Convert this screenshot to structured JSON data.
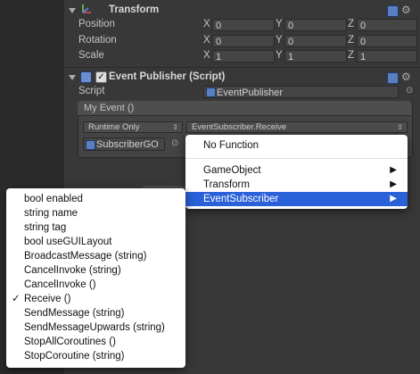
{
  "transform": {
    "title": "Transform",
    "rows": [
      {
        "label": "Position",
        "x": "0",
        "y": "0",
        "z": "0"
      },
      {
        "label": "Rotation",
        "x": "0",
        "y": "0",
        "z": "0"
      },
      {
        "label": "Scale",
        "x": "1",
        "y": "1",
        "z": "1"
      }
    ],
    "axes": [
      "X",
      "Y",
      "Z"
    ]
  },
  "event_publisher": {
    "title": "Event Publisher (Script)",
    "enabled": true,
    "script_label": "Script",
    "script_value": "EventPublisher",
    "event_header": "My Event ()",
    "runtime_dropdown": "Runtime Only",
    "function_dropdown": "EventSubscriber.Receive",
    "object_field": "SubscriberGO"
  },
  "component_menu": {
    "items": [
      {
        "label": "No Function",
        "submenu": false
      },
      {
        "label": "GameObject",
        "submenu": true
      },
      {
        "label": "Transform",
        "submenu": true
      },
      {
        "label": "EventSubscriber",
        "submenu": true,
        "active": true
      }
    ]
  },
  "method_menu": {
    "items": [
      {
        "label": "bool enabled",
        "checked": false
      },
      {
        "label": "string name",
        "checked": false
      },
      {
        "label": "string tag",
        "checked": false
      },
      {
        "label": "bool useGUILayout",
        "checked": false
      },
      {
        "label": "BroadcastMessage (string)",
        "checked": false
      },
      {
        "label": "CancelInvoke (string)",
        "checked": false
      },
      {
        "label": "CancelInvoke ()",
        "checked": false
      },
      {
        "label": "Receive ()",
        "checked": true
      },
      {
        "label": "SendMessage (string)",
        "checked": false
      },
      {
        "label": "SendMessageUpwards (string)",
        "checked": false
      },
      {
        "label": "StopAllCoroutines ()",
        "checked": false
      },
      {
        "label": "StopCoroutine (string)",
        "checked": false
      }
    ],
    "check_glyph": "✓"
  },
  "colors": {
    "highlight": "#2a60d8",
    "panel": "#383838"
  }
}
